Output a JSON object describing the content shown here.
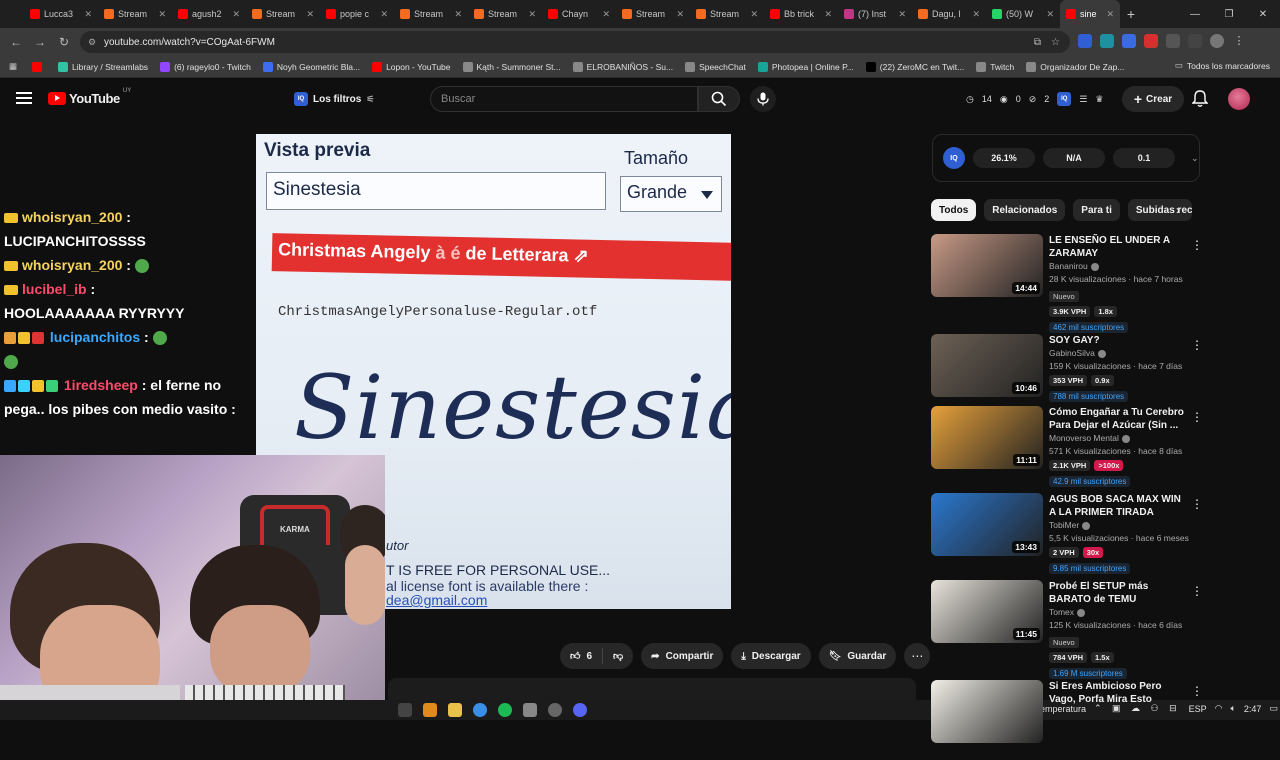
{
  "browser": {
    "tabs": [
      {
        "title": "Lucca3",
        "color": "#ff0000"
      },
      {
        "title": "Stream",
        "color": "#f26b21"
      },
      {
        "title": "agush2",
        "color": "#ff0000"
      },
      {
        "title": "Stream",
        "color": "#f26b21"
      },
      {
        "title": "popie c",
        "color": "#ff0000"
      },
      {
        "title": "Stream",
        "color": "#f26b21"
      },
      {
        "title": "Stream",
        "color": "#f26b21"
      },
      {
        "title": "Chayn",
        "color": "#ff0000"
      },
      {
        "title": "Stream",
        "color": "#f26b21"
      },
      {
        "title": "Stream",
        "color": "#f26b21"
      },
      {
        "title": "Bb trick",
        "color": "#ff0000"
      },
      {
        "title": "(7) Inst",
        "color": "#c13584"
      },
      {
        "title": "Dagu, l",
        "color": "#f26b21"
      },
      {
        "title": "(50) W",
        "color": "#25d366"
      },
      {
        "title": "sine",
        "color": "#ff0000"
      }
    ],
    "url": "youtube.com/watch?v=COgAat-6FWM",
    "bookmarks": [
      {
        "label": "",
        "color": "#ff0000"
      },
      {
        "label": "Library / Streamlabs",
        "color": "#31c3a2"
      },
      {
        "label": "(6) rageylo0 - Twitch",
        "color": "#9146ff"
      },
      {
        "label": "Noyh Geometric Bla...",
        "color": "#3d6cf0"
      },
      {
        "label": "Lopon - YouTube",
        "color": "#ff0000"
      },
      {
        "label": "Kąth - Summoner St...",
        "color": "#888888"
      },
      {
        "label": "ELROBANIÑOS - Su...",
        "color": "#888888"
      },
      {
        "label": "SpeechChat",
        "color": "#888888"
      },
      {
        "label": "Photopea | Online P...",
        "color": "#18a497"
      },
      {
        "label": "(22) ZeroMC en Twit...",
        "color": "#000000"
      },
      {
        "label": "Twitch",
        "color": "#888888"
      },
      {
        "label": "Organizador De Zap...",
        "color": "#888888"
      }
    ],
    "bookmarks_all": "Todos los marcadores"
  },
  "youtube": {
    "logo": "YouTube",
    "country": "UY",
    "filters_label": "Los filtros",
    "search_placeholder": "Buscar",
    "stats": {
      "a": "14",
      "b": "0",
      "c": "2"
    },
    "create_label": "Crear"
  },
  "chat": {
    "lines": [
      {
        "user": "whoisryan_200",
        "text": "LUCIPANCHITOSSSS"
      },
      {
        "user": "whoisryan_200",
        "text": ""
      },
      {
        "user": "lucibel_ib",
        "text": "HOOLAAAAAAA RYYRYYY"
      },
      {
        "user": "lucipanchitos",
        "text": ""
      },
      {
        "user": "1iredsheep",
        "text": "el ferne no pega.. los pibes con medio vasito :"
      }
    ]
  },
  "video": {
    "vista_previa": "Vista previa",
    "tamano": "Tamaño",
    "input_value": "Sinestesia",
    "select_value": "Grande",
    "banner": "Christmas Angely",
    "banner_mid": "à é",
    "banner_tail": "de Letterara",
    "file_name": "ChristmasAngelyPersonaluse-Regular.otf",
    "script_text": "Sinestesia",
    "autor": "utor",
    "free_text": "T IS FREE FOR PERSONAL USE...",
    "license_text": "al license font is available there :",
    "email_text": "dea@gmail.com",
    "cam_chair_brand": "KARMA"
  },
  "actions": {
    "likes": "6",
    "share": "Compartir",
    "download": "Descargar",
    "save": "Guardar"
  },
  "sidebar": {
    "iq_label": "IQ",
    "iq_values": [
      "26.1%",
      "N/A",
      "0.1"
    ],
    "chips": [
      "Todos",
      "Relacionados",
      "Para ti",
      "Subidas rec"
    ],
    "videos": [
      {
        "title": "LE ENSEÑO EL UNDER A ZARAMAY",
        "channel": "Bananirou",
        "meta": "28 K visualizaciones · hace 7 horas",
        "duration": "14:44",
        "nuevo": "Nuevo",
        "vph": "3.9K VPH",
        "mult": "1.8x",
        "subs": "462 mil suscriptores",
        "thumb": "#c89a86"
      },
      {
        "title": "SOY GAY?",
        "channel": "GabinoSilva",
        "meta": "159 K visualizaciones · hace 7 días",
        "duration": "10:46",
        "nuevo": "",
        "vph": "353 VPH",
        "mult": "0.9x",
        "subs": "788 mil suscriptores",
        "thumb": "#6d6155"
      },
      {
        "title": "Cómo Engañar a Tu Cerebro Para Dejar el Azúcar (Sin ...",
        "channel": "Monoverso Mental",
        "meta": "571 K visualizaciones · hace 8 días",
        "duration": "11:11",
        "nuevo": "",
        "vph": "2.1K VPH",
        "mult": ">100x",
        "subs": "42.9 mil suscriptores",
        "thumb": "#e6a13b"
      },
      {
        "title": "AGUS BOB SACA MAX WIN A LA PRIMER TIRADA",
        "channel": "TobiMer",
        "meta": "5,5 K visualizaciones · hace 6 meses",
        "duration": "13:43",
        "nuevo": "",
        "vph": "2 VPH",
        "mult": "30x",
        "subs": "9.85 mil suscriptores",
        "thumb": "#2a78d0"
      },
      {
        "title": "Probé El SETUP más BARATO de TEMU",
        "channel": "Tomex",
        "meta": "125 K visualizaciones · hace 6 días",
        "duration": "11:45",
        "nuevo": "Nuevo",
        "vph": "784 VPH",
        "mult": "1.5x",
        "subs": "1.69 M suscriptores",
        "thumb": "#e8e4dc"
      },
      {
        "title": "Si Eres Ambicioso Pero Vago, Porfa Mira Esto",
        "channel": "",
        "meta": "",
        "duration": "",
        "nuevo": "",
        "vph": "",
        "mult": "",
        "subs": "",
        "thumb": "#f2efe7"
      }
    ]
  },
  "taskbar": {
    "weather": "Temperatura",
    "lang": "ESP",
    "time": "2:47"
  }
}
